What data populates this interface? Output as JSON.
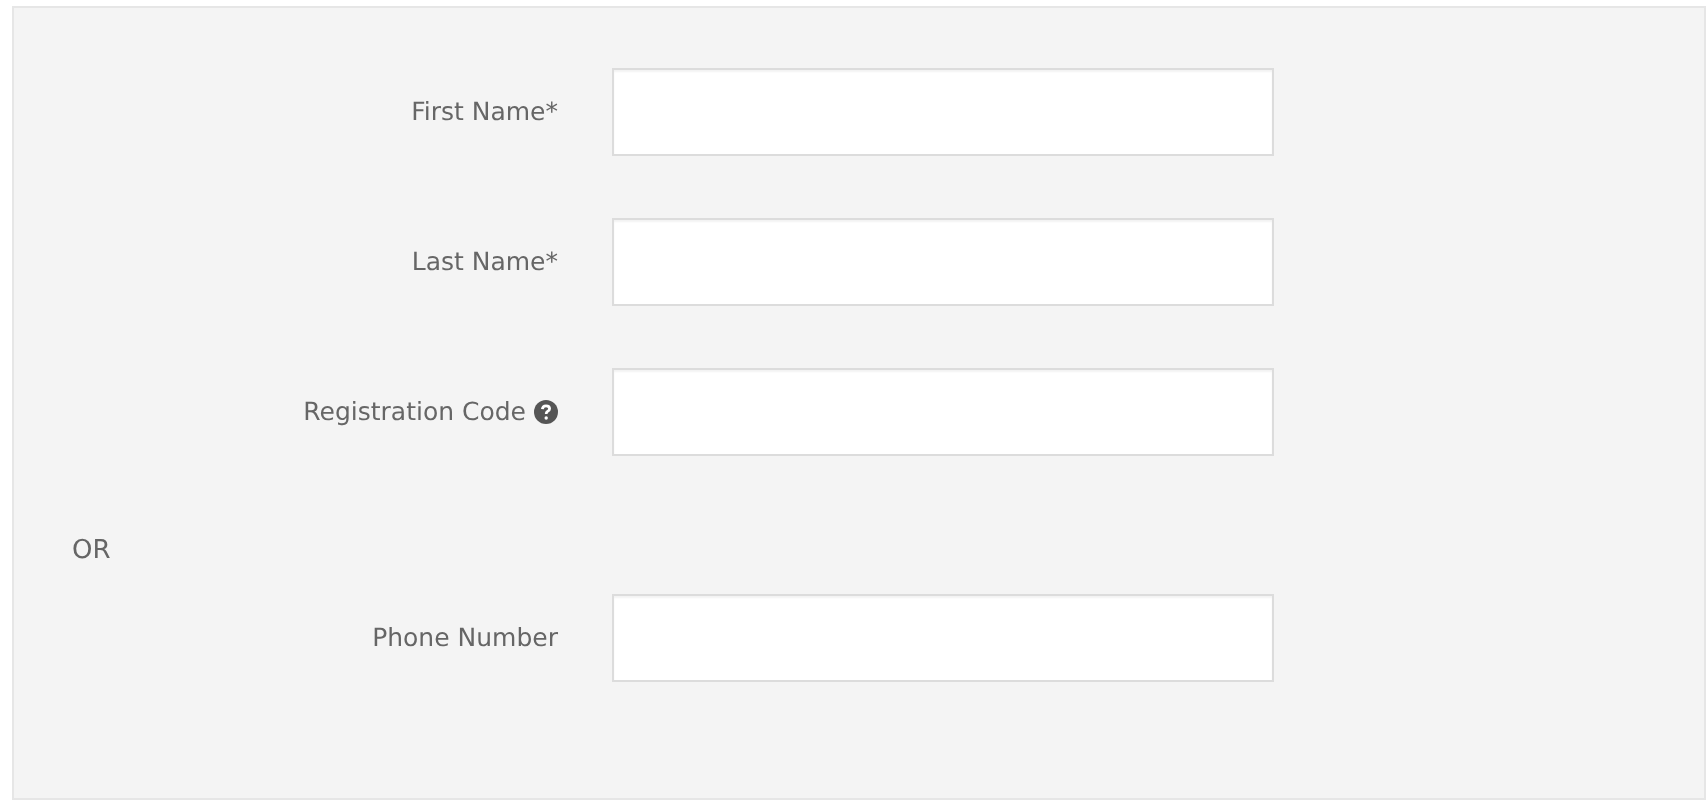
{
  "form": {
    "rows": [
      {
        "kind": "field",
        "label": "First Name*",
        "help": false
      },
      {
        "kind": "field",
        "label": "Last Name*",
        "help": false
      },
      {
        "kind": "field",
        "label": "Registration Code",
        "help": true
      },
      {
        "kind": "separator",
        "label": "OR"
      },
      {
        "kind": "field",
        "label": "Phone Number",
        "help": false
      }
    ]
  }
}
